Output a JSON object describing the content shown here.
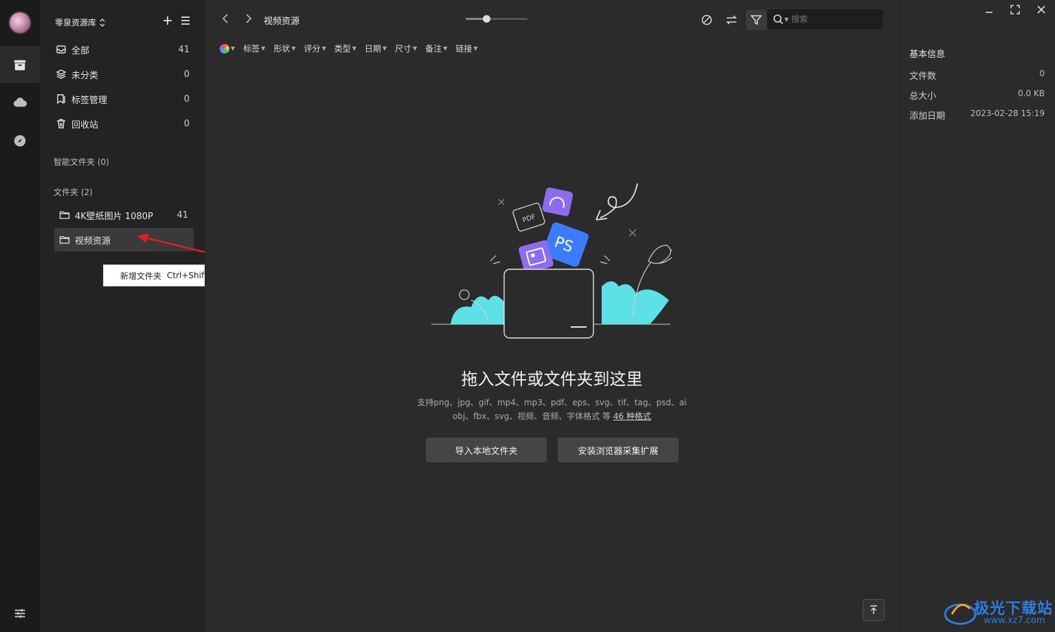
{
  "colors": {
    "accent_cyan": "#5ce1e6",
    "ps_blue": "#3a7bff",
    "purple": "#8c6cf0",
    "arrow_red": "#e02020",
    "brand_blue": "#2b7de0"
  },
  "sidebar": {
    "library_name": "零泉资源库",
    "nav": [
      {
        "icon": "inbox-icon",
        "label": "全部",
        "count": "41"
      },
      {
        "icon": "layers-icon",
        "label": "未分类",
        "count": "0"
      },
      {
        "icon": "tag-icon",
        "label": "标签管理",
        "count": "0"
      },
      {
        "icon": "trash-icon",
        "label": "回收站",
        "count": "0"
      }
    ],
    "smart_folders_label": "智能文件夹 (0)",
    "folders_label": "文件夹 (2)",
    "folders": [
      {
        "label": "4K壁纸图片 1080P",
        "count": "41"
      },
      {
        "label": "视频资源",
        "count": ""
      }
    ],
    "tooltip": {
      "label": "新增文件夹",
      "shortcut": "Ctrl+Shift+N"
    }
  },
  "main": {
    "breadcrumb": "视频资源",
    "zoom_level": 0.33,
    "search_placeholder": "搜索",
    "filters": [
      "标签",
      "形状",
      "评分",
      "类型",
      "日期",
      "尺寸",
      "备注",
      "链接"
    ],
    "empty_title": "拖入文件或文件夹到这里",
    "empty_desc_line1": "支持png、jpg、gif、mp4、mp3、pdf、eps、svg、tif、tag、psd、ai",
    "empty_desc_line2_prefix": "obj、fbx、svg、视频、音频、字体格式 等 ",
    "empty_desc_link": "46 种格式",
    "import_button": "导入本地文件夹",
    "extension_button": "安装浏览器采集扩展",
    "illustration_labels": {
      "pdf": "PDF",
      "ps": "PS"
    }
  },
  "info_panel": {
    "title": "基本信息",
    "rows": [
      {
        "label": "文件数",
        "value": "0"
      },
      {
        "label": "总大小",
        "value": "0.0 KB"
      },
      {
        "label": "添加日期",
        "value": "2023-02-28 15:19"
      }
    ]
  },
  "footer": {
    "help": "?"
  },
  "watermark": {
    "text": "极光下载站",
    "url": "www.xz7.com"
  }
}
